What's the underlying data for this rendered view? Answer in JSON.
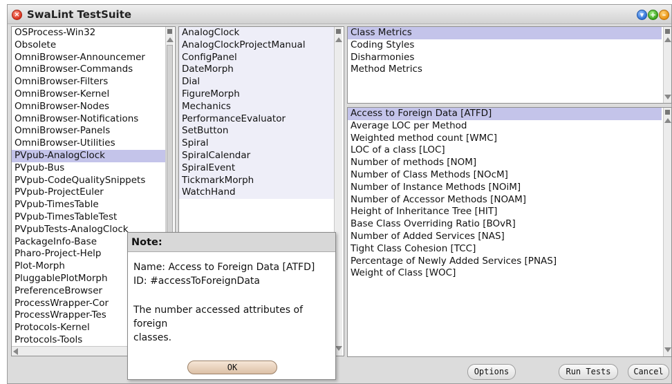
{
  "window": {
    "title": "SwaLint TestSuite"
  },
  "packages": {
    "items": [
      "OSProcess-Win32",
      "Obsolete",
      "OmniBrowser-Announcemer",
      "OmniBrowser-Commands",
      "OmniBrowser-Filters",
      "OmniBrowser-Kernel",
      "OmniBrowser-Nodes",
      "OmniBrowser-Notifications",
      "OmniBrowser-Panels",
      "OmniBrowser-Utilities",
      "PVpub-AnalogClock",
      "PVpub-Bus",
      "PVpub-CodeQualitySnippets",
      "PVpub-ProjectEuler",
      "PVpub-TimesTable",
      "PVpub-TimesTableTest",
      "PVpubTests-AnalogClock",
      "PackageInfo-Base",
      "Pharo-Project-Help",
      "Plot-Morph",
      "PluggablePlotMorph",
      "PreferenceBrowser",
      "ProcessWrapper-Cor",
      "ProcessWrapper-Tes",
      "Protocols-Kernel",
      "Protocols-Tools"
    ],
    "selected_index": 10
  },
  "classes": {
    "items": [
      "AnalogClock",
      "AnalogClockProjectManual",
      "ConfigPanel",
      "DateMorph",
      "Dial",
      "FigureMorph",
      "Mechanics",
      "PerformanceEvaluator",
      "SetButton",
      "Spiral",
      "SpiralCalendar",
      "SpiralEvent",
      "TickmarkMorph",
      "WatchHand"
    ]
  },
  "categories": {
    "items": [
      "Class Metrics",
      "Coding Styles",
      "Disharmonies",
      "Method Metrics"
    ],
    "selected_index": 0
  },
  "metrics": {
    "items": [
      "Access to Foreign Data [ATFD]",
      "Average LOC per Method",
      "Weighted method count [WMC]",
      "LOC of a class [LOC]",
      "Number of methods [NOM]",
      "Number of Class Methods [NOcM]",
      "Number of Instance Methods [NOiM]",
      "Number of Accessor Methods [NOAM]",
      "Height of Inheritance Tree [HIT]",
      "Base Class Overriding Ratio [BOvR]",
      "Number of Added Services [NAS]",
      "Tight Class Cohesion [TCC]",
      "Percentage of Newly Added Services [PNAS]",
      "Weight of Class [WOC]"
    ],
    "selected_index": 0
  },
  "note": {
    "title": "Note:",
    "name_line": "Name: Access to Foreign Data [ATFD]",
    "id_line": "ID: #accessToForeignData",
    "description_lines": [
      "The number accessed attributes of",
      "foreign",
      "classes."
    ],
    "ok_label": "OK"
  },
  "buttons": {
    "options": "Options",
    "run_tests": "Run Tests",
    "cancel": "Cancel"
  },
  "colors": {
    "selection": "#c4c4ea",
    "window_bg": "#dcdcdc"
  }
}
